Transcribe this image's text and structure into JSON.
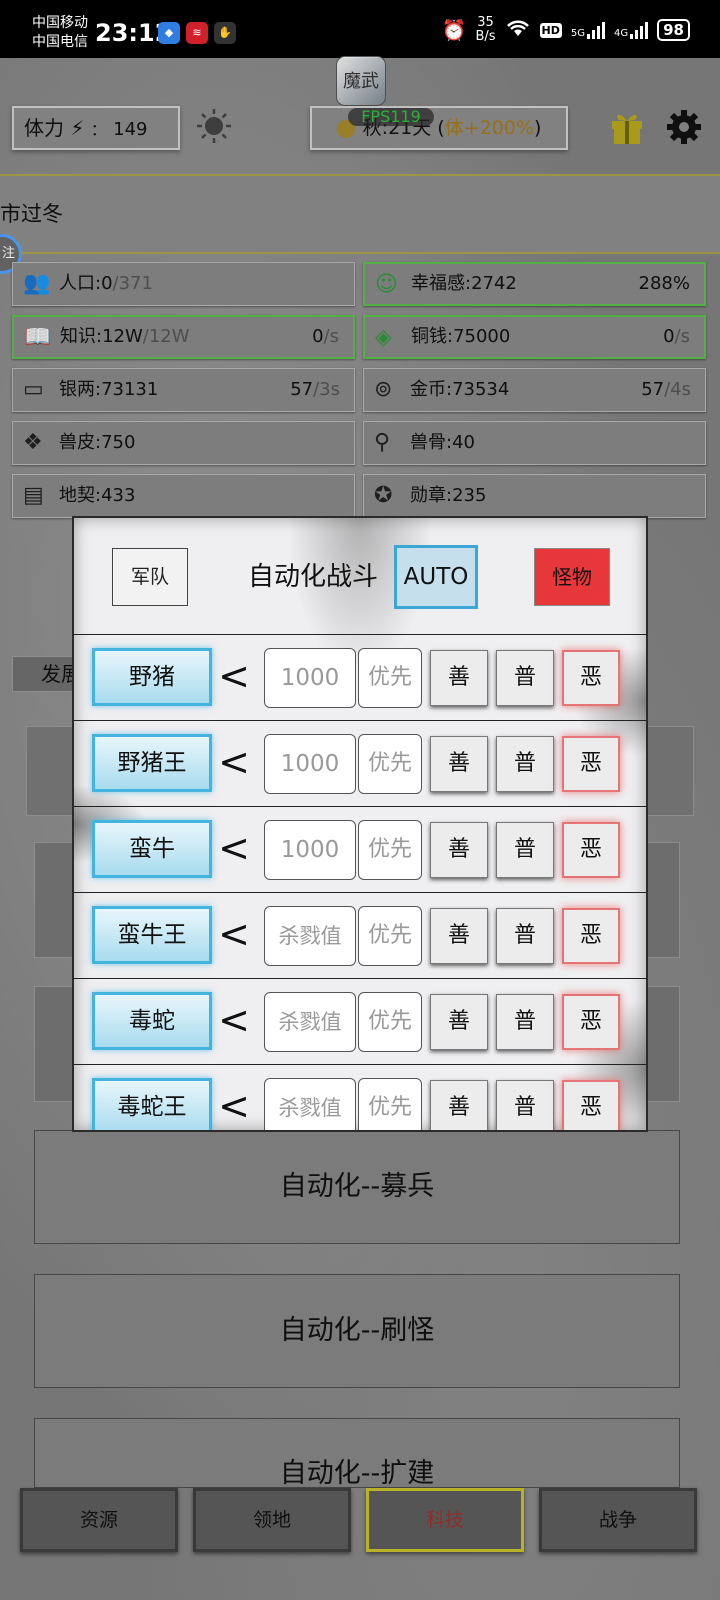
{
  "status_bar": {
    "carrier1": "中国移动",
    "carrier2": "中国电信",
    "time": "23:12",
    "net_speed_value": "35",
    "net_speed_unit": "B/s",
    "hd": "HD",
    "net1": "5G",
    "net2": "4G",
    "battery": "98"
  },
  "game": {
    "logo_text": "魔武",
    "fps": "FPS119",
    "stamina_label": "体力",
    "stamina_sep": "：",
    "stamina_value": "149",
    "season_text": "秋:21天 (",
    "season_bonus": "体+200%",
    "season_close": ")",
    "notice": "市过冬",
    "float_button": "注"
  },
  "resources": [
    {
      "icon": "people-icon",
      "label": "人口:0",
      "max": "/371",
      "rate": "",
      "per": "",
      "green": false
    },
    {
      "icon": "smile-icon",
      "label": "幸福感:2742",
      "max": "",
      "rate": "288%",
      "per": "",
      "green": true
    },
    {
      "icon": "book-icon",
      "label": "知识:12W",
      "max": "/12W",
      "rate": "0",
      "per": "/s",
      "green": true
    },
    {
      "icon": "coin-icon",
      "label": "铜钱:75000",
      "max": "",
      "rate": "0",
      "per": "/s",
      "green": true
    },
    {
      "icon": "silver-ingot-icon",
      "label": "银两:73131",
      "max": "",
      "rate": "57",
      "per": "/3s",
      "green": false
    },
    {
      "icon": "gold-coin-icon",
      "label": "金币:73534",
      "max": "",
      "rate": "57",
      "per": "/4s",
      "green": false
    },
    {
      "icon": "hide-icon",
      "label": "兽皮:750",
      "max": "",
      "rate": "",
      "per": "",
      "green": false
    },
    {
      "icon": "bone-icon",
      "label": "兽骨:40",
      "max": "",
      "rate": "",
      "per": "",
      "green": false
    },
    {
      "icon": "deed-icon",
      "label": "地契:433",
      "max": "",
      "rate": "",
      "per": "",
      "green": false
    },
    {
      "icon": "medal-icon",
      "label": "勋章:235",
      "max": "",
      "rate": "",
      "per": "",
      "green": false
    }
  ],
  "dev_tab": "发展",
  "automation_buttons": [
    "自动化--募兵",
    "自动化--刷怪",
    "自动化--扩建"
  ],
  "bottom_nav": [
    "资源",
    "领地",
    "科技",
    "战争"
  ],
  "modal": {
    "army_button": "军队",
    "title": "自动化战斗",
    "auto_button": "AUTO",
    "monster_button": "怪物",
    "priority_label": "优先",
    "less_than": "<",
    "option_good": "善",
    "option_normal": "普",
    "option_evil": "恶",
    "rows": [
      {
        "name": "野猪",
        "value": "1000"
      },
      {
        "name": "野猪王",
        "value": "1000"
      },
      {
        "name": "蛮牛",
        "value": "1000"
      },
      {
        "name": "蛮牛王",
        "value": "杀戮值"
      },
      {
        "name": "毒蛇",
        "value": "杀戮值"
      },
      {
        "name": "毒蛇王",
        "value": "杀戮值"
      }
    ]
  }
}
